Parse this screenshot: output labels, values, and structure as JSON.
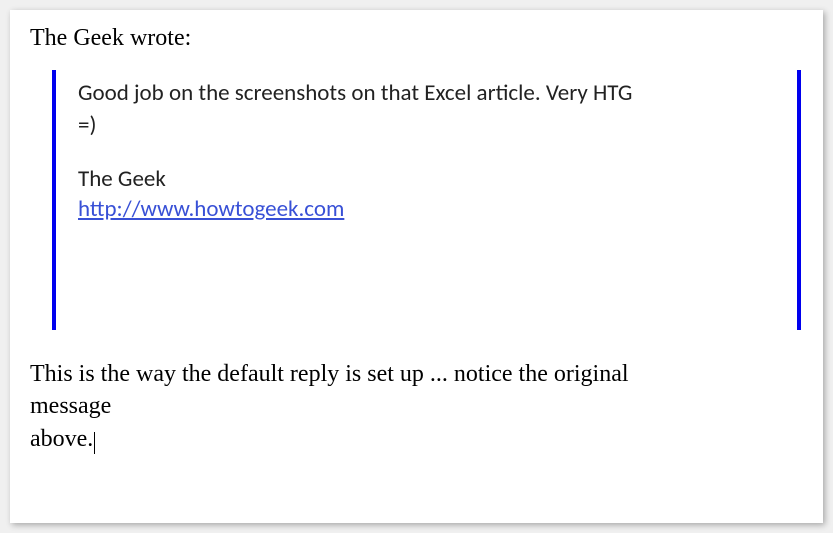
{
  "attribution": "The Geek wrote:",
  "quote": {
    "line1": "Good job on the screenshots on that Excel article. Very HTG",
    "line2": "=)",
    "signature_name": "The Geek",
    "signature_url": "http://www.howtogeek.com"
  },
  "reply": {
    "line1": "This is the way the default reply is set up ... notice the original",
    "line2": "message",
    "line3": "above."
  }
}
